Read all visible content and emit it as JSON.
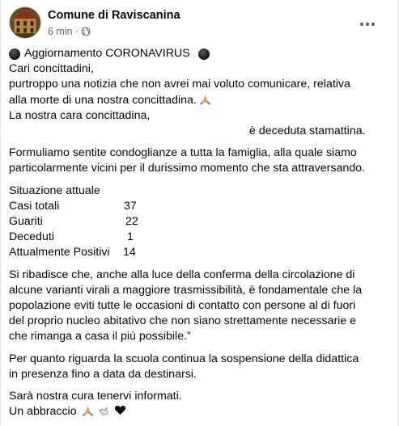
{
  "post": {
    "page_name": "Comune di Raviscanina",
    "timestamp": "6 min",
    "separator": "·",
    "headline": "Aggiornamento CORONAVIRUS",
    "greeting": "Cari concittadini,",
    "line1": "purtroppo una notizia che non avrei mai voluto comunicare, relativa",
    "line2": "alla morte di una nostra concittadina.",
    "line3": "La nostra cara concittadina,",
    "line4": "è deceduta stamattina.",
    "para2_line1": "Formuliamo sentite condoglianze a tutta la famiglia, alla quale siamo",
    "para2_line2": "particolarmente vicini per il durissimo momento che sta attraversando.",
    "stats_title": "Situazione attuale",
    "stats": [
      {
        "label": "Casi totali",
        "value": "37"
      },
      {
        "label": "Guariti",
        "value": "22"
      },
      {
        "label": "Deceduti",
        "value": "1"
      },
      {
        "label": "Attualmente Positivi",
        "value": "14"
      }
    ],
    "para3_line1": "Si ribadisce che, anche alla luce della conferma della circolazione di",
    "para3_line2": "alcune varianti virali a maggiore trasmissibilità, è fondamentale che la",
    "para3_line3": "popolazione eviti tutte le occasioni di contatto con persone al di fuori",
    "para3_line4": "del proprio nucleo abitativo che non siano strettamente necessarie e",
    "para3_line5": "che rimanga a casa il più possibile.”",
    "para4_line1": "Per quanto riguarda la scuola continua la sospensione della didattica",
    "para4_line2": "in presenza fino a data da destinarsi.",
    "para5_line1": "Sarà nostra cura tenervi informati.",
    "para5_line2": "Un abbraccio"
  },
  "icons": {
    "headline_marker": "black-circle-icon",
    "visibility": "globe-icon",
    "menu": "more-options-icon",
    "emoji_pray": "folded-hands-icon",
    "emoji_dove": "dove-icon",
    "emoji_heart": "black-heart-icon"
  },
  "colors": {
    "text": "#050505",
    "secondary_text": "#65676b"
  }
}
